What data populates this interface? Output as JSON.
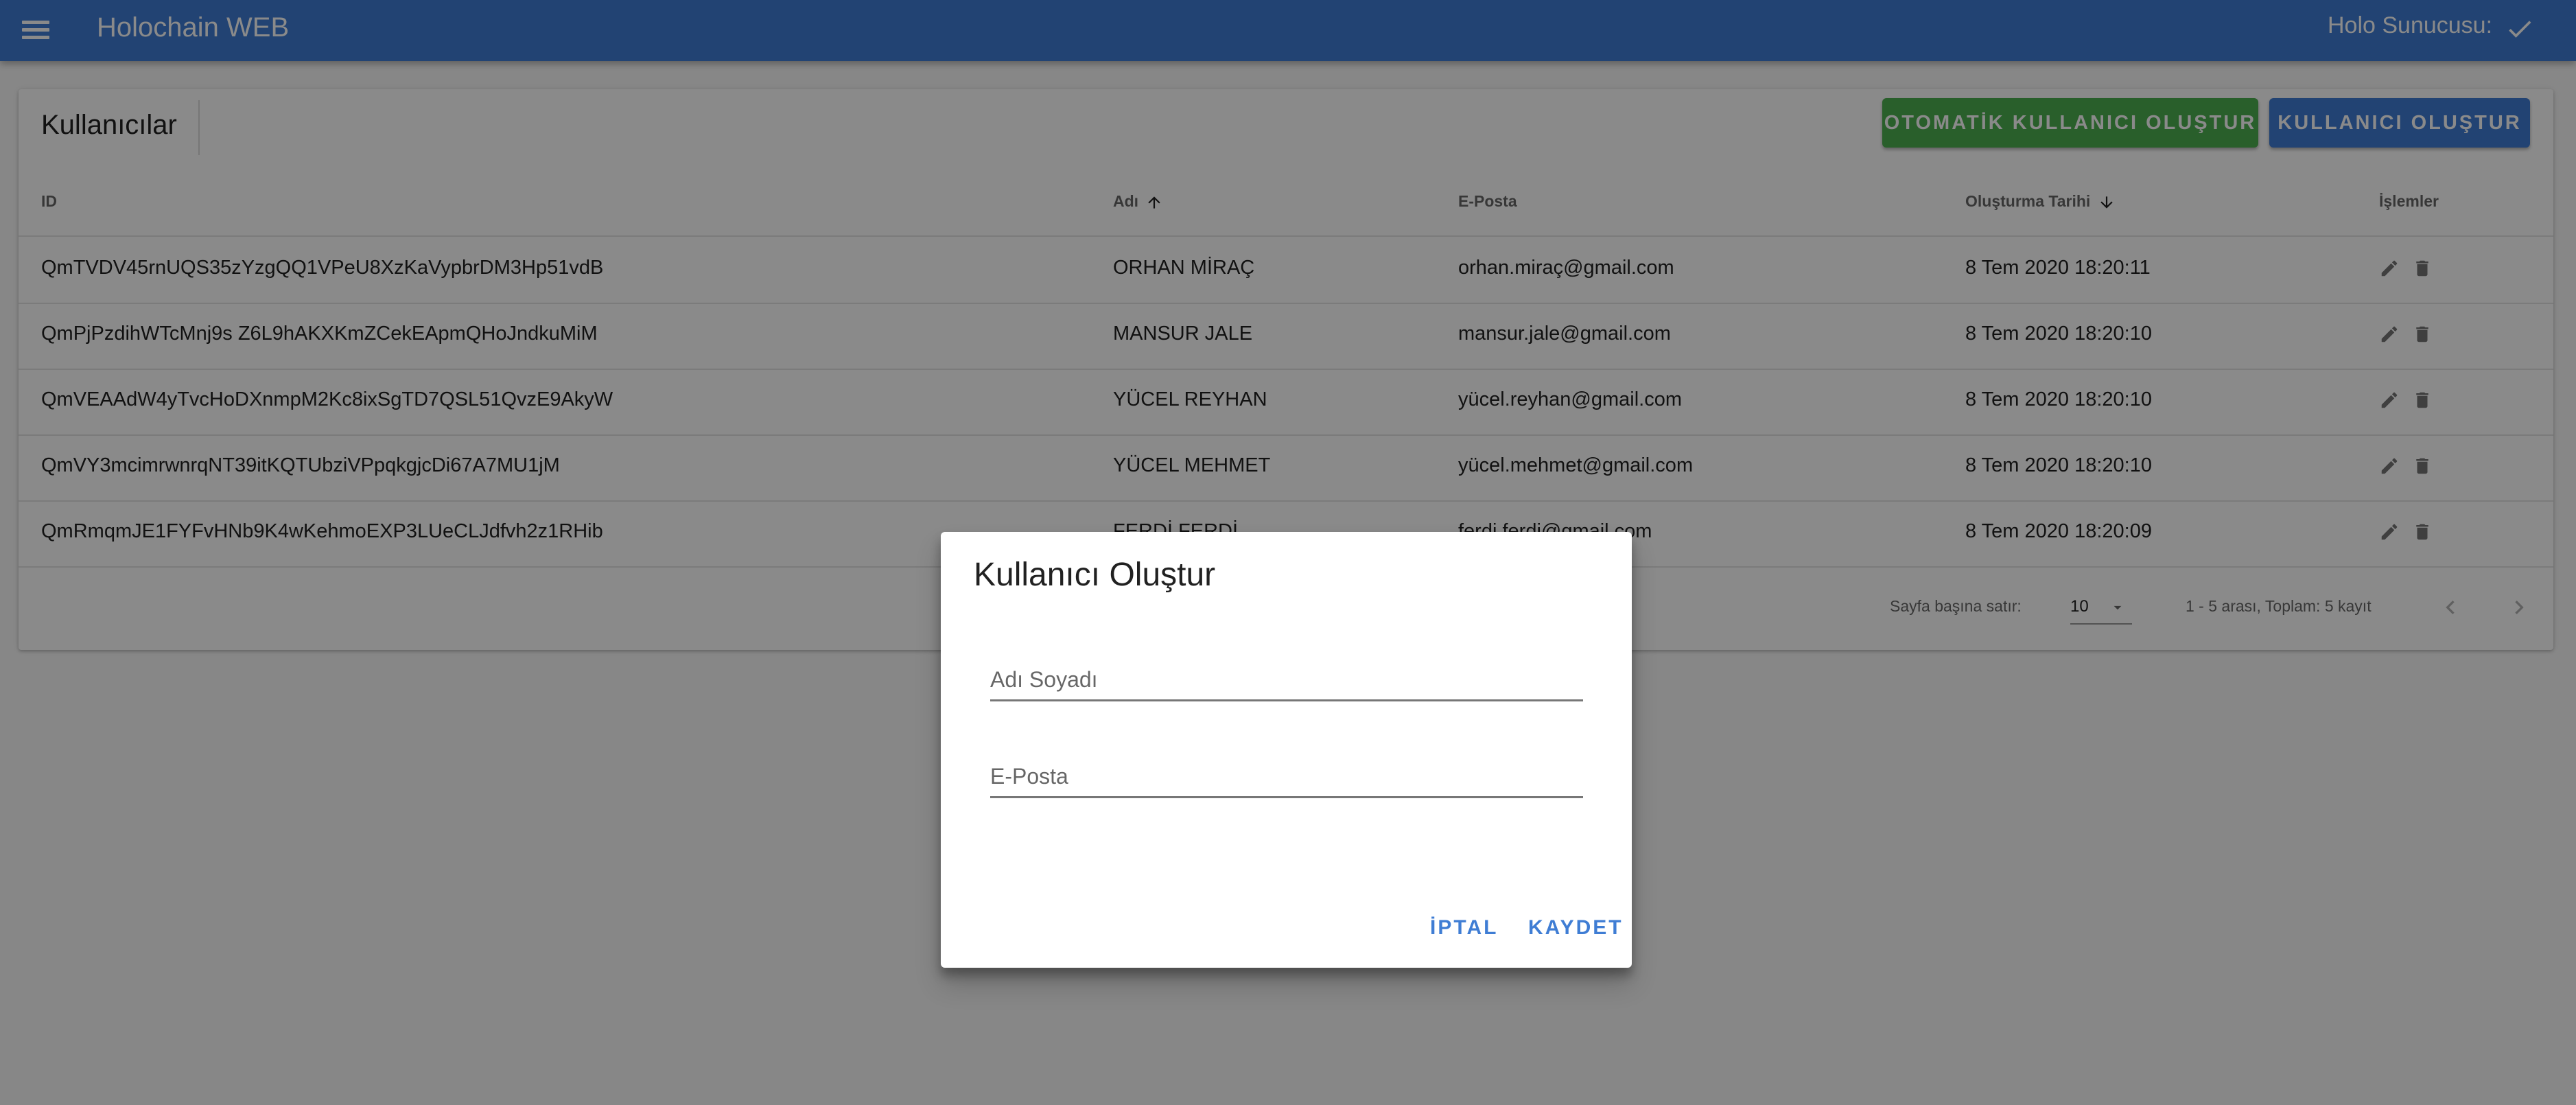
{
  "appbar": {
    "title": "Holochain WEB",
    "server_label": "Holo Sunucusu:",
    "menu_icon": "menu-icon",
    "status_icon": "check-icon"
  },
  "card": {
    "title": "Kullanıcılar",
    "auto_create_button": "OTOMATİK KULLANICI OLUŞTUR",
    "create_button": "KULLANICI OLUŞTUR"
  },
  "table": {
    "headers": {
      "id": "ID",
      "name": "Adı",
      "email": "E-Posta",
      "created": "Oluşturma Tarihi",
      "actions": "İşlemler"
    },
    "rows": [
      {
        "id": "QmTVDV45rnUQS35zYzgQQ1VPeU8XzKaVypbrDM3Hp51vdB",
        "name": "ORHAN MİRAÇ",
        "email": "orhan.miraç@gmail.com",
        "created": "8 Tem 2020 18:20:11"
      },
      {
        "id": "QmPjPzdihWTcMnj9s Z6L9hAKXKmZCekEApmQHoJndkuMiM",
        "name": "MANSUR JALE",
        "email": "mansur.jale@gmail.com",
        "created": "8 Tem 2020 18:20:10"
      },
      {
        "id": "QmVEAAdW4yTvcHoDXnmpM2Kc8ixSgTD7QSL51QvzE9AkyW",
        "name": "YÜCEL REYHAN",
        "email": "yücel.reyhan@gmail.com",
        "created": "8 Tem 2020 18:20:10"
      },
      {
        "id": "QmVY3mcimrwnrqNT39itKQTUbziVPpqkgjcDi67A7MU1jM",
        "name": "YÜCEL MEHMET",
        "email": "yücel.mehmet@gmail.com",
        "created": "8 Tem 2020 18:20:10"
      },
      {
        "id": "QmRmqmJE1FYFvHNb9K4wKehmoEXP3LUeCLJdfvh2z1RHib",
        "name": "FERDİ FERDİ",
        "email": "ferdi.ferdi@gmail.com",
        "created": "8 Tem 2020 18:20:09"
      }
    ]
  },
  "footer": {
    "rows_per_page_label": "Sayfa başına satır:",
    "rows_per_page_value": "10",
    "range_text": "1 - 5 arası, Toplam: 5 kayıt"
  },
  "dialog": {
    "title": "Kullanıcı Oluştur",
    "name_placeholder": "Adı Soyadı",
    "email_placeholder": "E-Posta",
    "cancel_label": "İPTAL",
    "save_label": "KAYDET"
  },
  "colors": {
    "primary": "#3f7dd4",
    "success": "#4caf50"
  }
}
